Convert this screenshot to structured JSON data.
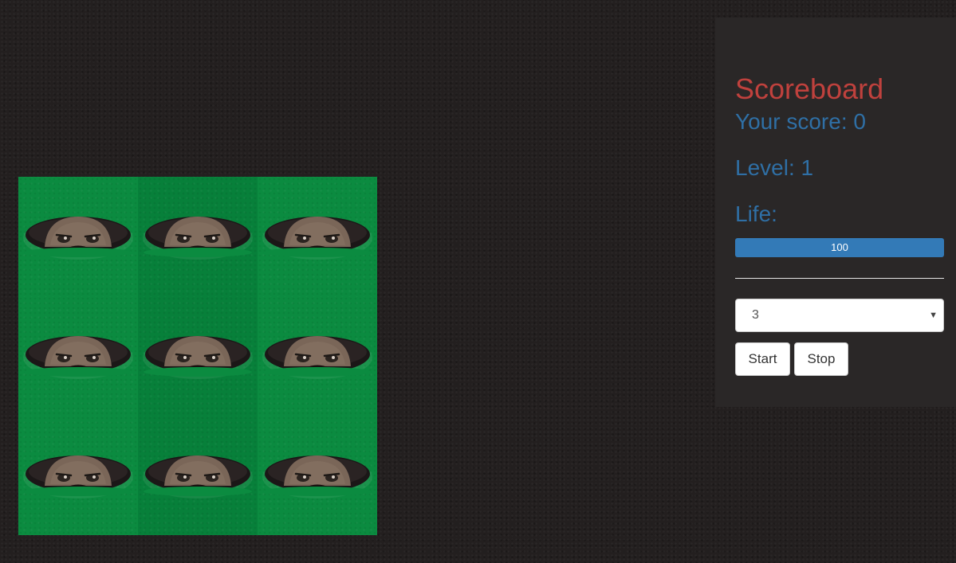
{
  "board": {
    "rows": 3,
    "cols": 3,
    "holes": [
      {
        "id": 1
      },
      {
        "id": 2
      },
      {
        "id": 3
      },
      {
        "id": 4
      },
      {
        "id": 5
      },
      {
        "id": 6
      },
      {
        "id": 7
      },
      {
        "id": 8
      },
      {
        "id": 9
      }
    ],
    "colors": {
      "grass": "#0b8b40",
      "hole": "#1b1717",
      "mole": "#7a6658"
    }
  },
  "scoreboard": {
    "title": "Scoreboard",
    "score_text": "Your score: 0",
    "level_text": "Level: 1",
    "life_label": "Life:",
    "life_value": 100,
    "life_text": "100",
    "select": {
      "selected": "3"
    },
    "start_label": "Start",
    "stop_label": "Stop",
    "colors": {
      "title": "#c0413d",
      "stat": "#2f6fa5",
      "progress": "#337ab7"
    }
  }
}
